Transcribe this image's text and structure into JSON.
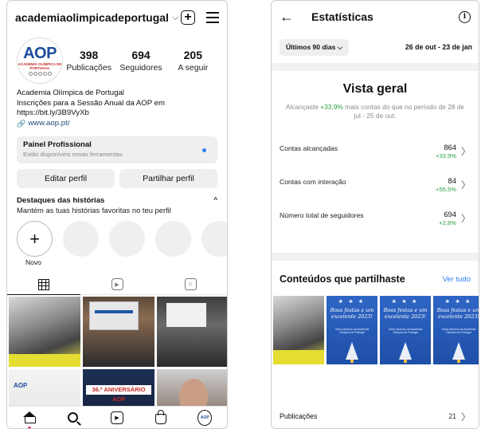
{
  "profile": {
    "username": "academiaolimpicadeportugal",
    "logo_text": "AOP",
    "logo_sub": "ACADEMIA OLÍMPICA DE PORTUGAL",
    "stats": [
      {
        "value": "398",
        "label": "Publicações"
      },
      {
        "value": "694",
        "label": "Seguidores"
      },
      {
        "value": "205",
        "label": "A seguir"
      }
    ],
    "bio_name": "Academia Olímpica de Portugal",
    "bio_line1": "Inscrições para a Sessão Anual da AOP em",
    "bio_line2": "https://bit.ly/3B9VyXb",
    "bio_link": "www.aop.pt/",
    "pro_title": "Painel Profissional",
    "pro_sub": "Estão disponíveis novas ferramentas.",
    "edit_button": "Editar perfil",
    "share_button": "Partilhar perfil",
    "highlights_title": "Destaques das histórias",
    "highlights_sub": "Mantém as tuas histórias favoritas no teu perfil",
    "new_story_label": "Novo",
    "post_badge": "AOP",
    "post_announcement": "36.º ANIVERSÁRIO AOP"
  },
  "stats_page": {
    "title": "Estatísticas",
    "filter": "Últimos 90 dias",
    "date_range": "26 de out - 23 de jan",
    "overview_title": "Vista geral",
    "overview_pre": "Alcançaste ",
    "overview_change": "+33,9%",
    "overview_post": " mais contas do que no período de 28 de jul - 25 de out.",
    "metrics": [
      {
        "label": "Contas alcançadas",
        "value": "864",
        "change": "+33,9%"
      },
      {
        "label": "Contas com interação",
        "value": "84",
        "change": "+55,5%"
      },
      {
        "label": "Número total de seguidores",
        "value": "694",
        "change": "+2,8%"
      }
    ],
    "shared_title": "Conteúdos que partilhaste",
    "see_all": "Ver tudo",
    "card_script": "Boas festas e um excelente 2023!",
    "card_small": "Votos sinceros da Academia Olímpica de Portugal",
    "publications_label": "Publicações",
    "publications_count": "21"
  },
  "colors": {
    "positive": "#2aa147",
    "link_blue": "#2f80ed",
    "brand_blue": "#1c4b9c"
  }
}
